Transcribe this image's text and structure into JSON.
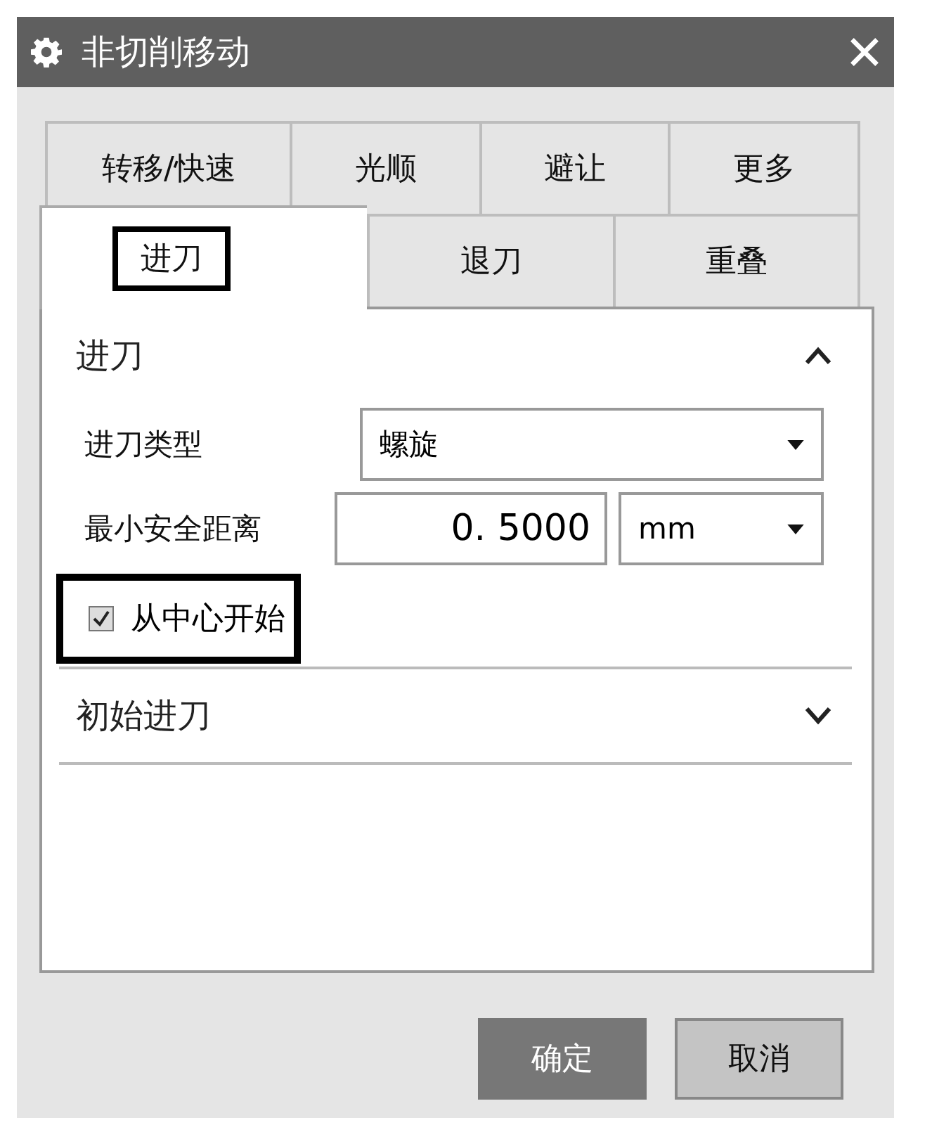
{
  "window": {
    "title": "非切削移动"
  },
  "tab_rows": [
    {
      "tabs": [
        {
          "label": "转移/快速",
          "selected": false,
          "highlighted": false
        },
        {
          "label": "光顺",
          "selected": false,
          "highlighted": false
        },
        {
          "label": "避让",
          "selected": false,
          "highlighted": false
        },
        {
          "label": "更多",
          "selected": false,
          "highlighted": false
        }
      ]
    },
    {
      "tabs": [
        {
          "label": "进刀",
          "selected": true,
          "highlighted": true
        },
        {
          "label": "退刀",
          "selected": false,
          "highlighted": false
        },
        {
          "label": "重叠",
          "selected": false,
          "highlighted": false
        }
      ]
    }
  ],
  "sections": [
    {
      "title": "进刀",
      "expanded": true,
      "fields": [
        {
          "kind": "dropdown",
          "label": "进刀类型",
          "value": "螺旋"
        },
        {
          "kind": "number_unit",
          "label": "最小安全距离",
          "value": "0. 5000",
          "unit": "mm"
        },
        {
          "kind": "checkbox",
          "label": "从中心开始",
          "checked": true,
          "highlighted": true
        }
      ]
    },
    {
      "title": "初始进刀",
      "expanded": false
    }
  ],
  "buttons": [
    {
      "label": "确定",
      "kind": "primary"
    },
    {
      "label": "取消",
      "kind": "secondary"
    }
  ]
}
